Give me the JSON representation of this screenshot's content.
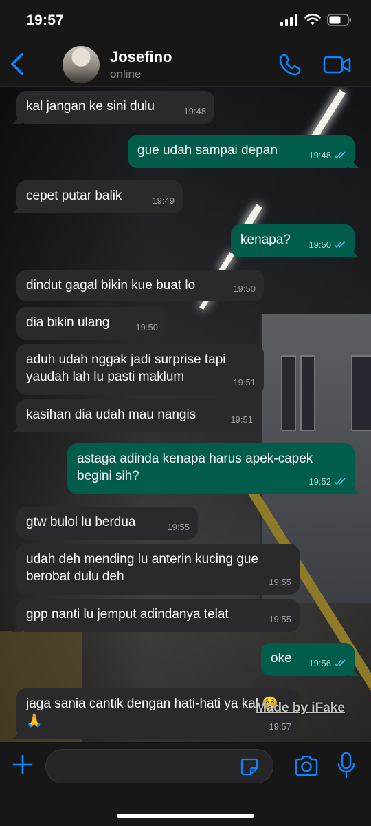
{
  "status_bar": {
    "time": "19:57"
  },
  "header": {
    "contact_name": "Josefino",
    "contact_status": "online"
  },
  "messages": [
    {
      "text": "kal jangan ke sini dulu",
      "time": "19:48",
      "direction": "in"
    },
    {
      "text": "gue udah sampai depan",
      "time": "19:48",
      "direction": "out",
      "read": true
    },
    {
      "text": "cepet putar balik",
      "time": "19:49",
      "direction": "in"
    },
    {
      "text": "kenapa?",
      "time": "19:50",
      "direction": "out",
      "read": true
    },
    {
      "text": "dindut gagal bikin kue buat lo",
      "time": "19:50",
      "direction": "in"
    },
    {
      "text": "dia bikin ulang",
      "time": "19:50",
      "direction": "in"
    },
    {
      "text": "aduh udah nggak jadi surprise tapi yaudah lah lu pasti maklum",
      "time": "19:51",
      "direction": "in"
    },
    {
      "text": "kasihan dia udah mau nangis",
      "time": "19:51",
      "direction": "in"
    },
    {
      "text": "astaga adinda kenapa harus apek-capek begini sih?",
      "time": "19:52",
      "direction": "out",
      "read": true
    },
    {
      "text": "gtw bulol lu berdua",
      "time": "19:55",
      "direction": "in"
    },
    {
      "text": "udah deh mending lu anterin kucing gue berobat dulu deh",
      "time": "19:55",
      "direction": "in"
    },
    {
      "text": "gpp nanti lu jemput adindanya telat",
      "time": "19:55",
      "direction": "in"
    },
    {
      "text": "oke",
      "time": "19:56",
      "direction": "out",
      "read": true
    },
    {
      "text": "jaga sania cantik dengan hati-hati ya kal ☺️🙏",
      "time": "19:57",
      "direction": "in"
    }
  ],
  "watermark": "Made by iFake",
  "colors": {
    "accent": "#0a84ff",
    "outgoing_bubble": "#005c4b",
    "incoming_bubble": "#2a2a2c",
    "read_tick": "#53bdeb"
  },
  "icons": [
    "back-chevron-icon",
    "phone-icon",
    "video-camera-icon",
    "plus-icon",
    "sticker-icon",
    "camera-icon",
    "microphone-icon",
    "double-check-icon"
  ]
}
